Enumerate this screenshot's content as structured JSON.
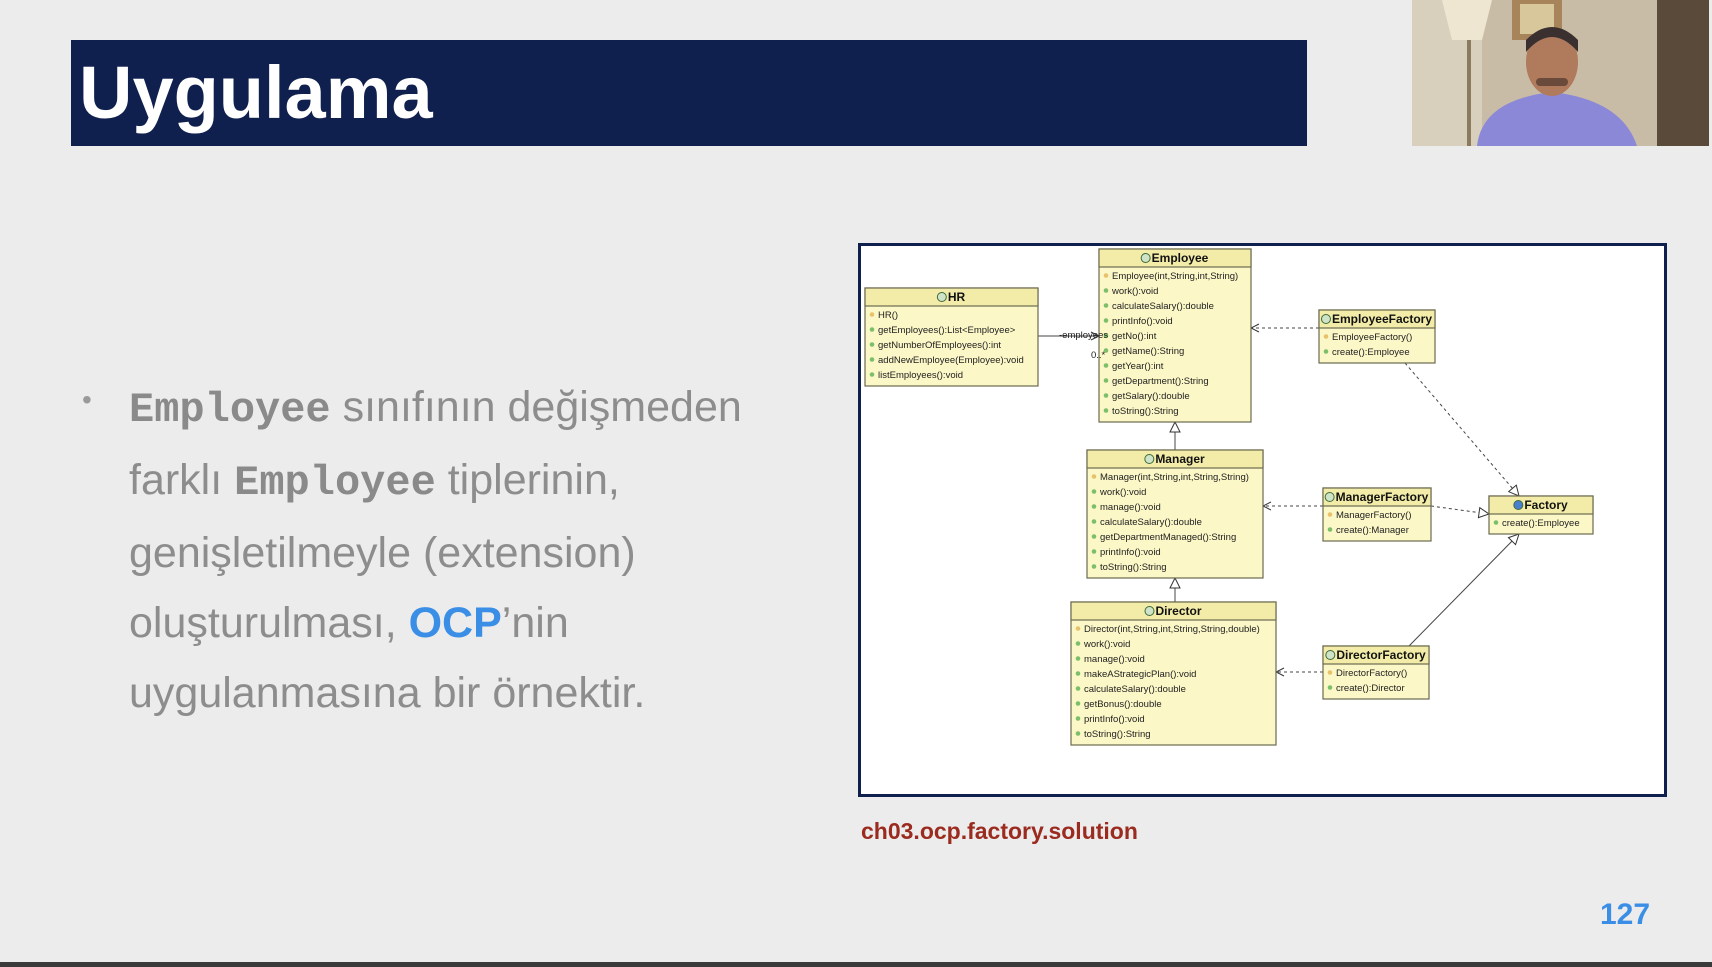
{
  "slide": {
    "title": "Uygulama",
    "page_number": "127",
    "caption": "ch03.ocp.factory.solution"
  },
  "bullet": {
    "code_word_1": "Employee",
    "text_1": " sınıfının değişmeden",
    "text_2": "farklı ",
    "code_word_2": "Employee",
    "text_3": " tiplerinin,",
    "text_4": "genişletilmeyle (extension)",
    "text_5": "oluşturulması, ",
    "highlight": "OCP",
    "text_6": "’nin",
    "text_7": "uygulanmasına bir örnektir."
  },
  "diagram": {
    "classes": [
      {
        "name": "HR",
        "kind": "class",
        "members": [
          "HR()",
          "getEmployees():List<Employee>",
          "getNumberOfEmployees():int",
          "addNewEmployee(Employee):void",
          "listEmployees():void"
        ]
      },
      {
        "name": "Employee",
        "kind": "class",
        "members": [
          "Employee(int,String,int,String)",
          "work():void",
          "calculateSalary():double",
          "printInfo():void",
          "getNo():int",
          "getName():String",
          "getYear():int",
          "getDepartment():String",
          "getSalary():double",
          "toString():String"
        ]
      },
      {
        "name": "EmployeeFactory",
        "kind": "class",
        "members": [
          "EmployeeFactory()",
          "create():Employee"
        ]
      },
      {
        "name": "Manager",
        "kind": "class",
        "members": [
          "Manager(int,String,int,String,String)",
          "work():void",
          "manage():void",
          "calculateSalary():double",
          "getDepartmentManaged():String",
          "printInfo():void",
          "toString():String"
        ]
      },
      {
        "name": "ManagerFactory",
        "kind": "class",
        "members": [
          "ManagerFactory()",
          "create():Manager"
        ]
      },
      {
        "name": "Factory",
        "kind": "interface",
        "members": [
          "create():Employee"
        ]
      },
      {
        "name": "Director",
        "kind": "class",
        "members": [
          "Director(int,String,int,String,String,double)",
          "work():void",
          "manage():void",
          "makeAStrategicPlan():void",
          "calculateSalary():double",
          "getBonus():double",
          "printInfo():void",
          "toString():String"
        ]
      },
      {
        "name": "DirectorFactory",
        "kind": "class",
        "members": [
          "DirectorFactory()",
          "create():Director"
        ]
      }
    ],
    "assoc_role": "-employees",
    "assoc_mult": "0..*"
  },
  "colors": {
    "title_bar": "#0f1f4e",
    "accent": "#3a8ee6",
    "caption": "#9b2b1f",
    "uml_fill": "#fbf7c6",
    "uml_header": "#f3eca8"
  }
}
